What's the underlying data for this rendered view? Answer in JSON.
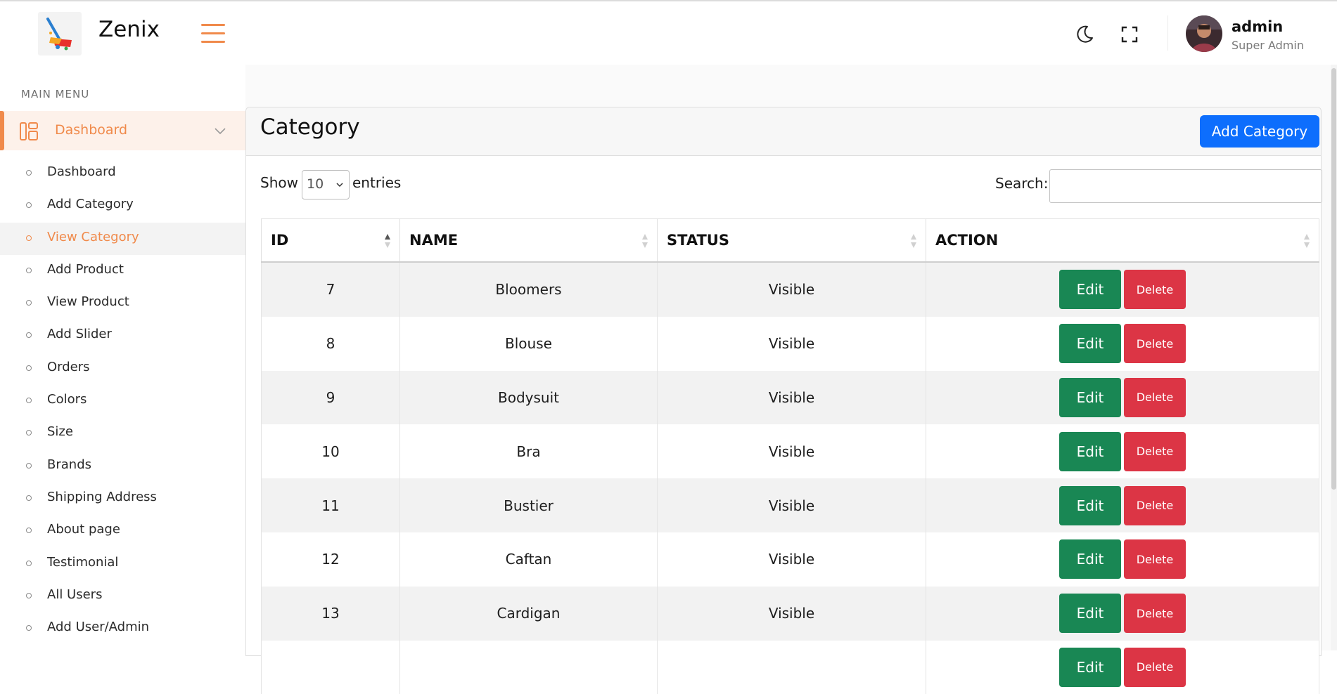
{
  "header": {
    "brand": "Zenix",
    "user_name": "admin",
    "user_role": "Super Admin"
  },
  "sidebar": {
    "heading": "MAIN MENU",
    "active_section": "Dashboard",
    "items": [
      {
        "label": "Dashboard"
      },
      {
        "label": "Add Category"
      },
      {
        "label": "View Category",
        "active": true
      },
      {
        "label": "Add Product"
      },
      {
        "label": "View Product"
      },
      {
        "label": "Add Slider"
      },
      {
        "label": "Orders"
      },
      {
        "label": "Colors"
      },
      {
        "label": "Size"
      },
      {
        "label": "Brands"
      },
      {
        "label": "Shipping Address"
      },
      {
        "label": "About page"
      },
      {
        "label": "Testimonial"
      },
      {
        "label": "All Users"
      },
      {
        "label": "Add User/Admin"
      }
    ]
  },
  "page": {
    "title": "Category",
    "add_button": "Add Category",
    "show_label": "Show",
    "entries_value": "10",
    "entries_label": "entries",
    "search_label": "Search:",
    "search_value": ""
  },
  "table": {
    "columns": [
      "ID",
      "NAME",
      "STATUS",
      "ACTION"
    ],
    "edit_label": "Edit",
    "delete_label": "Delete",
    "rows": [
      {
        "id": "7",
        "name": "Bloomers",
        "status": "Visible"
      },
      {
        "id": "8",
        "name": "Blouse",
        "status": "Visible"
      },
      {
        "id": "9",
        "name": "Bodysuit",
        "status": "Visible"
      },
      {
        "id": "10",
        "name": "Bra",
        "status": "Visible"
      },
      {
        "id": "11",
        "name": "Bustier",
        "status": "Visible"
      },
      {
        "id": "12",
        "name": "Caftan",
        "status": "Visible"
      },
      {
        "id": "13",
        "name": "Cardigan",
        "status": "Visible"
      },
      {
        "id": "",
        "name": "",
        "status": ""
      }
    ]
  },
  "colors": {
    "accent": "#f08a4b",
    "primary": "#0d6efd",
    "success": "#198754",
    "danger": "#dc3545"
  },
  "icons": {
    "menu": "hamburger-icon",
    "theme": "moon-icon",
    "fullscreen": "expand-icon",
    "dashboard": "dashboard-layout-icon",
    "collapse": "chevron-down-icon"
  }
}
